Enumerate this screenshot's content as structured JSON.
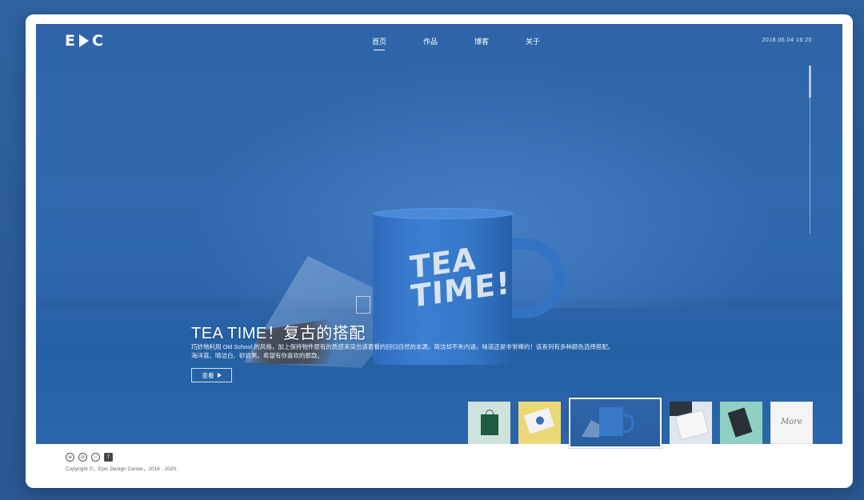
{
  "header": {
    "logo_text": "E▶C",
    "nav": [
      {
        "label": "首页",
        "active": true
      },
      {
        "label": "作品",
        "active": false
      },
      {
        "label": "博客",
        "active": false
      },
      {
        "label": "关于",
        "active": false
      }
    ],
    "datetime": "2018.06.04  16:20"
  },
  "hero": {
    "mug_text": "TEA\nTIME!",
    "headline": "TEA TIME！复古的搭配",
    "description": "巧妙地利用 Old School 的风格，加上保持物件原有的质感来突出该套餐的回归自然的本源。简洁却不失内涵，味道还是非常棒的！该系列有多种颜色选择搭配。海洋蓝、晴洁白、砂岩黑。希望有你喜欢的那款。",
    "view_button": "查看"
  },
  "thumbnails": [
    {
      "name": "shopping-bag",
      "selected": false
    },
    {
      "name": "notepad",
      "selected": false
    },
    {
      "name": "tea-time-mug",
      "selected": true
    },
    {
      "name": "brochure",
      "selected": false
    },
    {
      "name": "book",
      "selected": false
    },
    {
      "name": "more",
      "label": "More",
      "selected": false
    }
  ],
  "footer": {
    "social_icons": [
      "weibo-icon",
      "dribbble-icon",
      "instagram-icon",
      "facebook-icon"
    ],
    "copyright": "Copyright ©，Epic Design Center，2016 - 2020."
  },
  "colors": {
    "background": "#2f62a0",
    "hero_blue": "#3069ad",
    "mug_blue": "#3b7fd2",
    "panel": "#ffffff"
  }
}
